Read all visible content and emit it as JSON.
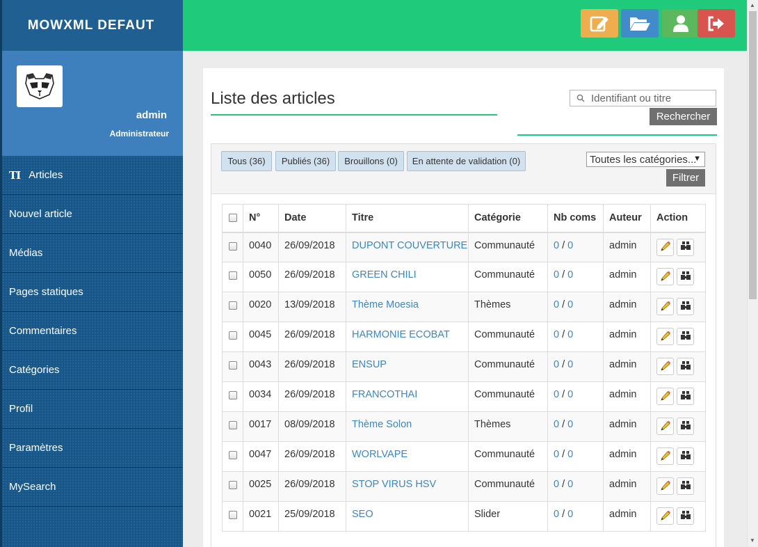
{
  "sidebar": {
    "brand": "MOWXML DEFAUT",
    "user_name": "admin",
    "user_role": "Administrateur",
    "articles_icon": "TI",
    "items": [
      {
        "label": "Articles"
      },
      {
        "label": "Nouvel article"
      },
      {
        "label": "Médias"
      },
      {
        "label": "Pages statiques"
      },
      {
        "label": "Commentaires"
      },
      {
        "label": "Catégories"
      },
      {
        "label": "Profil"
      },
      {
        "label": "Paramètres"
      },
      {
        "label": "MySearch"
      }
    ]
  },
  "topbar": {
    "buttons": [
      {
        "icon": "edit-icon",
        "color": "#f0ad4e"
      },
      {
        "icon": "folder-open-icon",
        "color": "#428bca"
      },
      {
        "icon": "user-icon",
        "color": "#5cb85c"
      },
      {
        "icon": "logout-icon",
        "color": "#d9534f"
      }
    ]
  },
  "main": {
    "title": "Liste des articles",
    "search": {
      "placeholder": "Identifiant ou titre",
      "button": "Rechercher"
    },
    "filters": [
      {
        "label": "Tous (36)"
      },
      {
        "label": "Publiés (36)"
      },
      {
        "label": "Brouillons (0)"
      },
      {
        "label": "En attente de validation (0)"
      }
    ],
    "category_select": "Toutes les catégories...",
    "filter_button": "Filtrer",
    "table": {
      "headers": [
        "N°",
        "Date",
        "Titre",
        "Catégorie",
        "Nb coms",
        "Auteur",
        "Action"
      ],
      "rows": [
        {
          "num": "0040",
          "date": "26/09/2018",
          "title": "DUPONT COUVERTURE",
          "category": "Communauté",
          "coms_a": "0",
          "sep": "/",
          "coms_b": "0",
          "author": "admin"
        },
        {
          "num": "0050",
          "date": "26/09/2018",
          "title": "GREEN CHILI",
          "category": "Communauté",
          "coms_a": "0",
          "sep": "/",
          "coms_b": "0",
          "author": "admin"
        },
        {
          "num": "0020",
          "date": "13/09/2018",
          "title": "Thème Moesia",
          "category": "Thèmes",
          "coms_a": "0",
          "sep": "/",
          "coms_b": "0",
          "author": "admin"
        },
        {
          "num": "0045",
          "date": "26/09/2018",
          "title": "HARMONIE ECOBAT",
          "category": "Communauté",
          "coms_a": "0",
          "sep": "/",
          "coms_b": "0",
          "author": "admin"
        },
        {
          "num": "0043",
          "date": "26/09/2018",
          "title": "ENSUP",
          "category": "Communauté",
          "coms_a": "0",
          "sep": "/",
          "coms_b": "0",
          "author": "admin"
        },
        {
          "num": "0034",
          "date": "26/09/2018",
          "title": "FRANCOTHAI",
          "category": "Communauté",
          "coms_a": "0",
          "sep": "/",
          "coms_b": "0",
          "author": "admin"
        },
        {
          "num": "0017",
          "date": "08/09/2018",
          "title": "Thème Solon",
          "category": "Thèmes",
          "coms_a": "0",
          "sep": "/",
          "coms_b": "0",
          "author": "admin"
        },
        {
          "num": "0047",
          "date": "26/09/2018",
          "title": "WORLVAPE",
          "category": "Communauté",
          "coms_a": "0",
          "sep": "/",
          "coms_b": "0",
          "author": "admin"
        },
        {
          "num": "0025",
          "date": "26/09/2018",
          "title": "STOP VIRUS HSV",
          "category": "Communauté",
          "coms_a": "0",
          "sep": "/",
          "coms_b": "0",
          "author": "admin"
        },
        {
          "num": "0021",
          "date": "25/09/2018",
          "title": "SEO",
          "category": "Slider",
          "coms_a": "0",
          "sep": "/",
          "coms_b": "0",
          "author": "admin"
        }
      ]
    }
  }
}
